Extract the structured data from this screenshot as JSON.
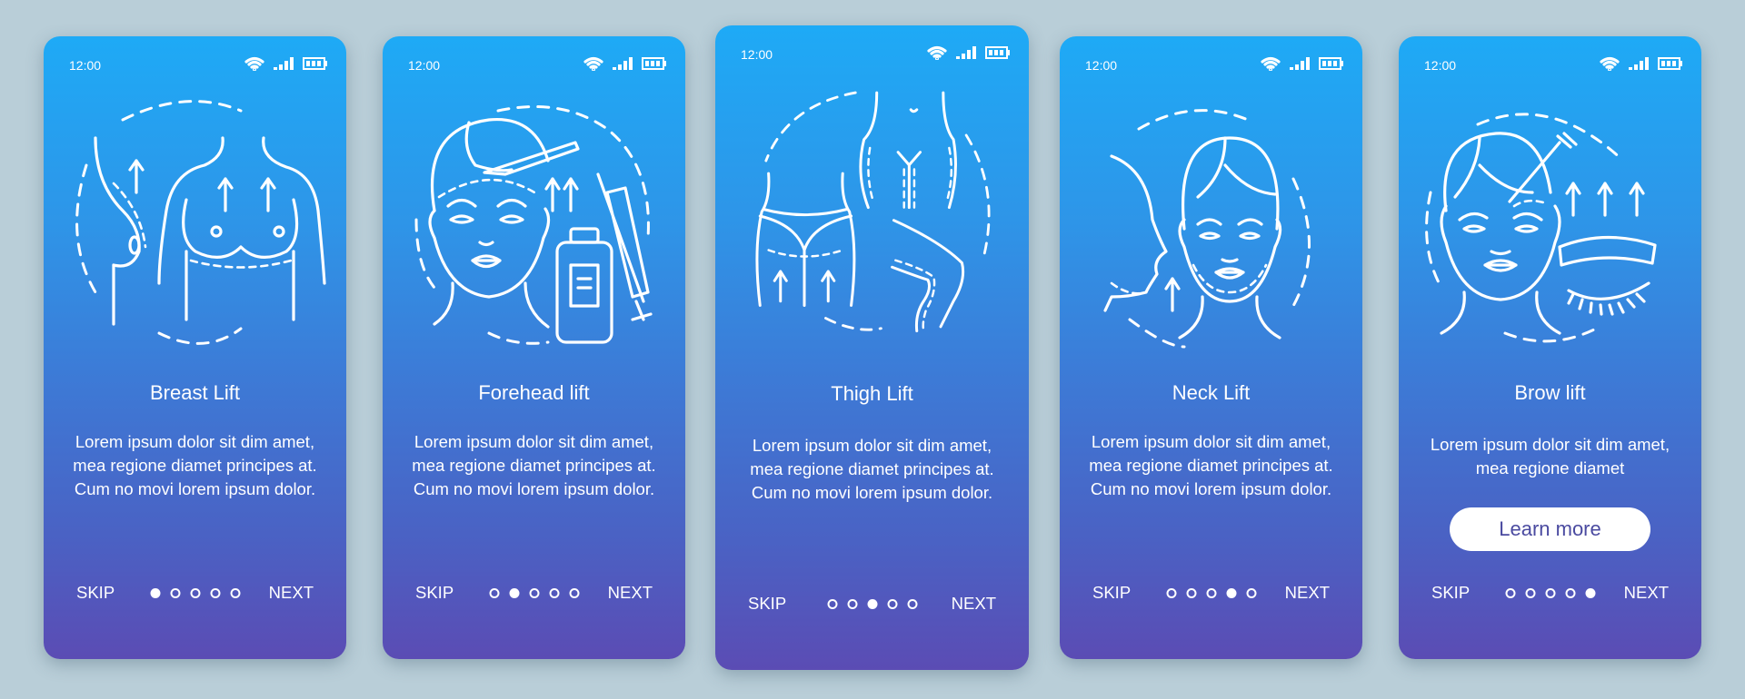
{
  "status_bar": {
    "time": "12:00",
    "icons": [
      "wifi-icon",
      "signal-icon",
      "battery-icon"
    ]
  },
  "colors": {
    "background": "#b9ced8",
    "gradient_top": "#1eaaf6",
    "gradient_bottom": "#5b4cb4",
    "button_text": "#4a4aa0"
  },
  "screens": [
    {
      "title": "Breast Lift",
      "illustration": "breast-lift-illustration",
      "description": "Lorem ipsum dolor sit dim amet, mea regione diamet principes at. Cum no movi lorem ipsum dolor.",
      "skip_label": "SKIP",
      "next_label": "NEXT",
      "active_page": 1,
      "total_pages": 5
    },
    {
      "title": "Forehead lift",
      "illustration": "forehead-lift-illustration",
      "description": "Lorem ipsum dolor sit dim amet, mea regione diamet principes at. Cum no movi lorem ipsum dolor.",
      "skip_label": "SKIP",
      "next_label": "NEXT",
      "active_page": 2,
      "total_pages": 5
    },
    {
      "title": "Thigh Lift",
      "illustration": "thigh-lift-illustration",
      "description": "Lorem ipsum dolor sit dim amet, mea regione diamet principes at. Cum no movi lorem ipsum dolor.",
      "skip_label": "SKIP",
      "next_label": "NEXT",
      "active_page": 3,
      "total_pages": 5
    },
    {
      "title": "Neck Lift",
      "illustration": "neck-lift-illustration",
      "description": "Lorem ipsum dolor sit dim amet, mea regione diamet principes at. Cum no movi lorem ipsum dolor.",
      "skip_label": "SKIP",
      "next_label": "NEXT",
      "active_page": 4,
      "total_pages": 5
    },
    {
      "title": "Brow lift",
      "illustration": "brow-lift-illustration",
      "description": "Lorem ipsum dolor sit dim amet, mea regione diamet",
      "button_label": "Learn more",
      "skip_label": "SKIP",
      "next_label": "NEXT",
      "active_page": 5,
      "total_pages": 5
    }
  ]
}
